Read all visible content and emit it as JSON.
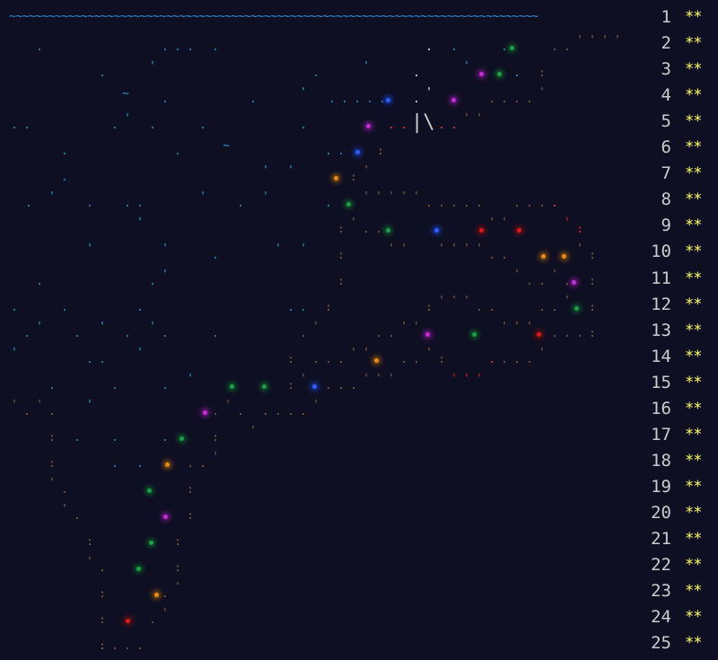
{
  "calendar": {
    "wave_line": "~~~~~~~~~~~~~~~~~~~~~~~~~~~~~~~~~~~~~~~~~~~~~~~~~~~~~~~~~~~~~~~~~~~~~~~~~~~~~~~~~",
    "days": [
      {
        "day": "1",
        "stars": "**"
      },
      {
        "day": "2",
        "stars": "**"
      },
      {
        "day": "3",
        "stars": "**"
      },
      {
        "day": "4",
        "stars": "**"
      },
      {
        "day": "5",
        "stars": "**"
      },
      {
        "day": "6",
        "stars": "**"
      },
      {
        "day": "7",
        "stars": "**"
      },
      {
        "day": "8",
        "stars": "**"
      },
      {
        "day": "9",
        "stars": "**"
      },
      {
        "day": "10",
        "stars": "**"
      },
      {
        "day": "11",
        "stars": "**"
      },
      {
        "day": "12",
        "stars": "**"
      },
      {
        "day": "13",
        "stars": "**"
      },
      {
        "day": "14",
        "stars": "**"
      },
      {
        "day": "15",
        "stars": "**"
      },
      {
        "day": "16",
        "stars": "**"
      },
      {
        "day": "17",
        "stars": "**"
      },
      {
        "day": "18",
        "stars": "**"
      },
      {
        "day": "19",
        "stars": "**"
      },
      {
        "day": "20",
        "stars": "**"
      },
      {
        "day": "21",
        "stars": "**"
      },
      {
        "day": "22",
        "stars": "**"
      },
      {
        "day": "23",
        "stars": "**"
      },
      {
        "day": "24",
        "stars": "**"
      },
      {
        "day": "25",
        "stars": "**"
      }
    ],
    "door_glyph": "|\\",
    "colors": {
      "background": "#0f0f23",
      "star": "#ffff66",
      "day_number": "#cccccc",
      "sea": "#2f8fd8",
      "trail": "#8f6a3e"
    }
  }
}
